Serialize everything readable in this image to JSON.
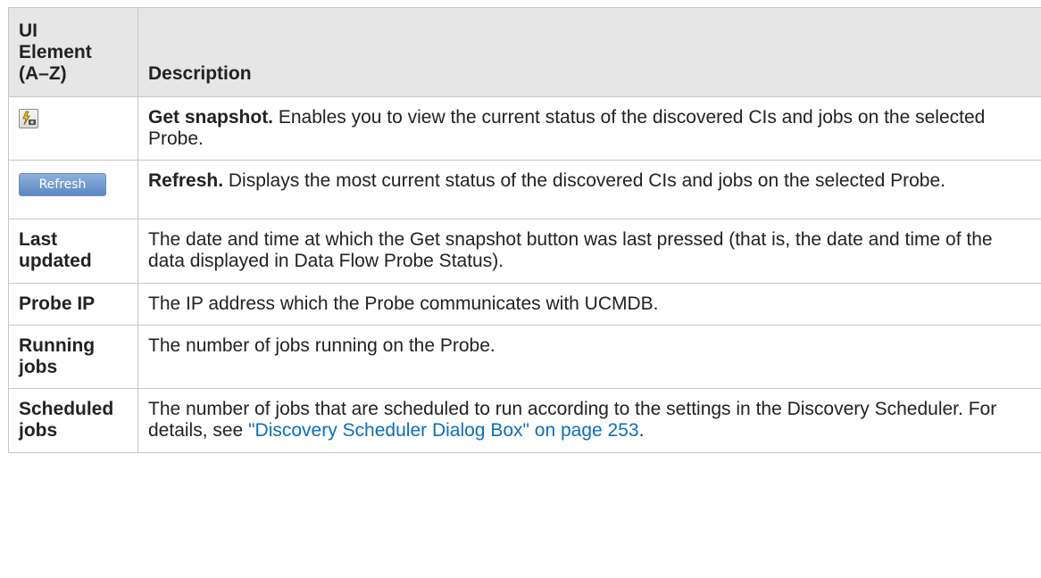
{
  "header": {
    "col1": "UI Element (A–Z)",
    "col1_lines": [
      "UI",
      "Element",
      "(A–Z)"
    ],
    "col2": "Description"
  },
  "rows": [
    {
      "icon": "get-snapshot-icon",
      "lead": "Get snapshot.",
      "text": " Enables you to view the current status of the discovered CIs and jobs on the selected Probe."
    },
    {
      "button_label": "Refresh",
      "lead": "Refresh.",
      "text": " Displays the most current status of the discovered CIs and jobs on the selected Probe."
    },
    {
      "name_lines": [
        "Last",
        "updated"
      ],
      "text": "The date and time at which the Get snapshot button was last pressed (that is, the date and time of the data displayed in Data Flow Probe Status)."
    },
    {
      "name_lines": [
        "Probe IP"
      ],
      "text": "The IP address which the Probe communicates with UCMDB."
    },
    {
      "name_lines": [
        "Running",
        "jobs"
      ],
      "text": "The number of jobs running on the Probe."
    },
    {
      "name_lines": [
        "Scheduled",
        "jobs"
      ],
      "text": "The number of jobs that are scheduled to run according to the settings in the Discovery Scheduler. For details, see ",
      "link": "\"Discovery Scheduler Dialog Box\" on page 253",
      "text_after": "."
    }
  ],
  "colors": {
    "header_bg": "#e6e6e6",
    "border": "#c6c6c6",
    "link": "#0a6ebd",
    "button": "#5b87c3"
  }
}
